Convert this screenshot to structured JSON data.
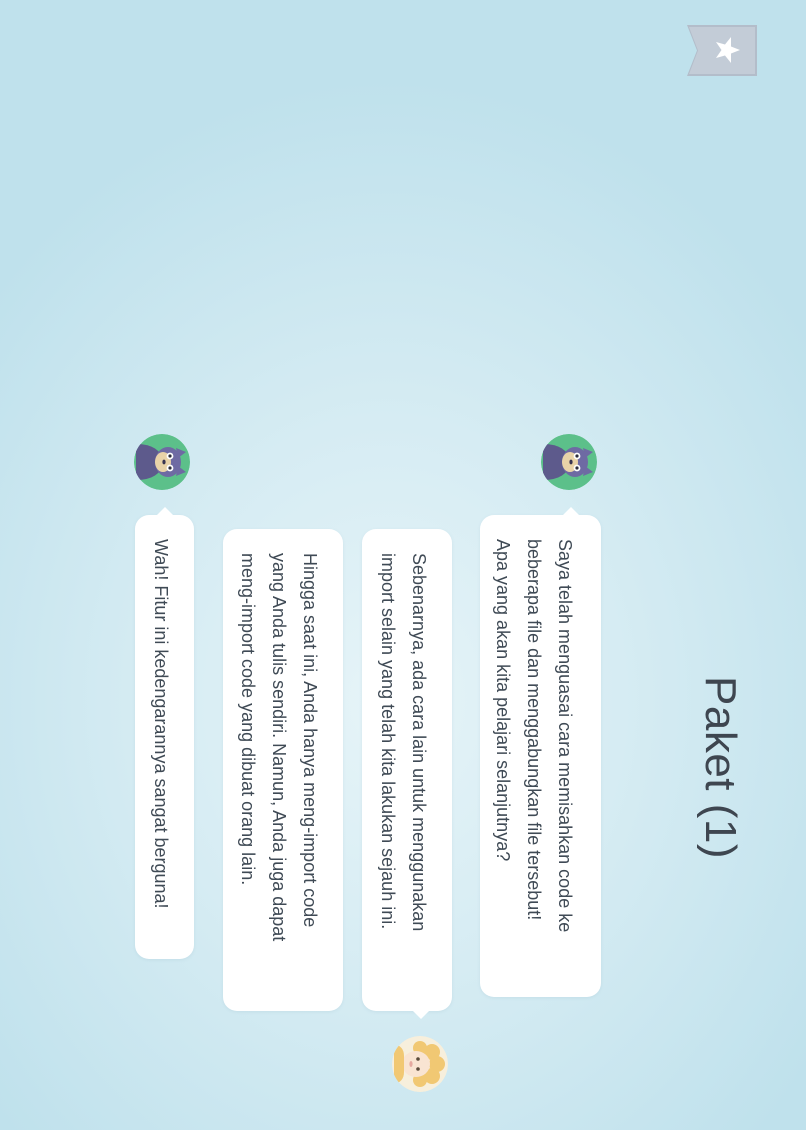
{
  "lesson": {
    "title": "Paket (1)"
  },
  "icons": {
    "bookmark": "star-bookmark-icon",
    "character_wolf": "wolf-avatar-icon",
    "character_sheep": "sheep-avatar-icon"
  },
  "colors": {
    "bookmark": "#b5bfcb",
    "wolf_avatar_bg": "#5cc08a",
    "bubble": "#ffffff",
    "text": "#3f4a55"
  },
  "dialogue": [
    {
      "speaker": "wolf",
      "lines": [
        "Saya telah menguasai cara memisahkan code ke",
        "beberapa file dan menggabungkan file tersebut!",
        "Apa yang akan kita pelajari selanjutnya?"
      ]
    },
    {
      "speaker": "sheep",
      "lines": [
        "Sebenarnya, ada cara lain untuk menggunakan",
        "import selain yang telah kita lakukan sejauh ini."
      ]
    },
    {
      "speaker": "sheep",
      "lines": [
        "Hingga saat ini, Anda hanya meng-import code",
        "yang Anda tulis sendiri. Namun, Anda juga dapat",
        "meng-import code yang dibuat orang lain."
      ]
    },
    {
      "speaker": "wolf",
      "lines": [
        "Wah! Fitur ini kedengarannya sangat berguna!"
      ]
    }
  ]
}
